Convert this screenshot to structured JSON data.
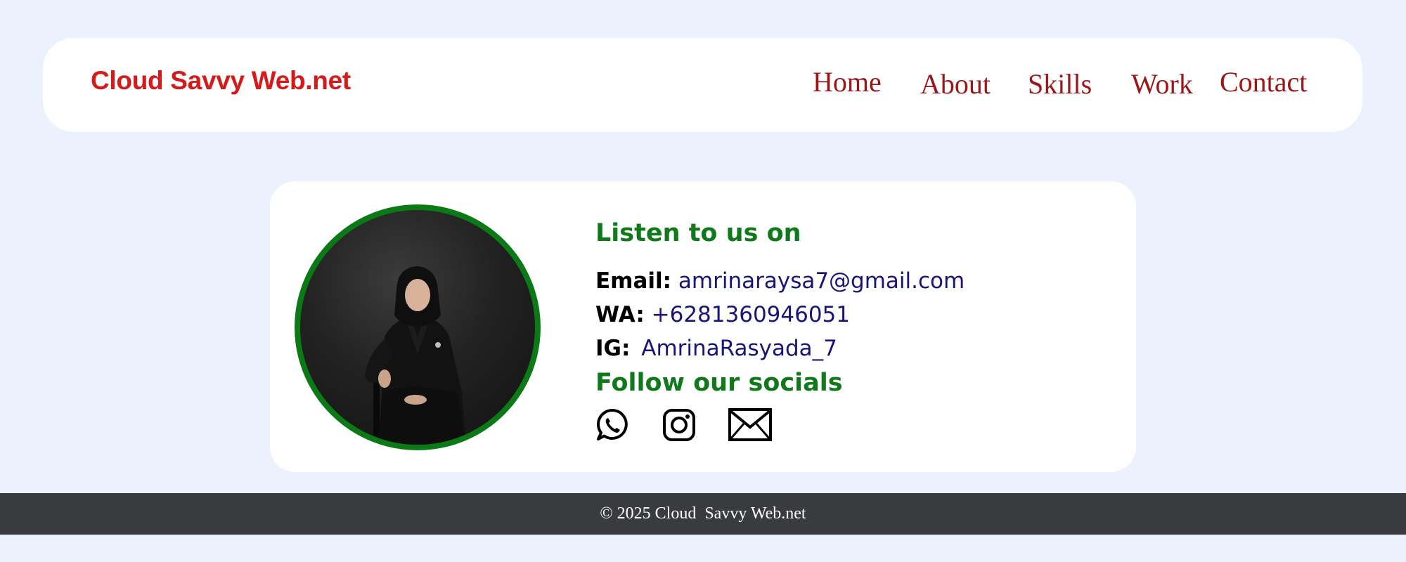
{
  "header": {
    "brand": "Cloud Savvy Web.net",
    "nav": {
      "home": "Home",
      "about": "About",
      "skills": "Skills",
      "work": "Work",
      "contact": "Contact"
    }
  },
  "contact_card": {
    "listen_heading": "Listen to us on",
    "email": {
      "label": "Email:",
      "value": "amrinaraysa7@gmail.com"
    },
    "wa": {
      "label": "WA:",
      "value": "+6281360946051"
    },
    "ig": {
      "label": "IG:",
      "value": "AmrinaRasyada_7"
    },
    "follow_heading": "Follow our socials",
    "social_icons": [
      "whatsapp-icon",
      "instagram-icon",
      "mail-icon"
    ]
  },
  "footer": {
    "text": "© 2025 Cloud  Savvy Web.net"
  },
  "colors": {
    "background": "#ebf1fd",
    "brand": "#d51a1a",
    "nav_link": "#9b1616",
    "heading_green": "#10791c",
    "link_value": "#1b1477",
    "footer_bg": "#3a3b3f"
  }
}
